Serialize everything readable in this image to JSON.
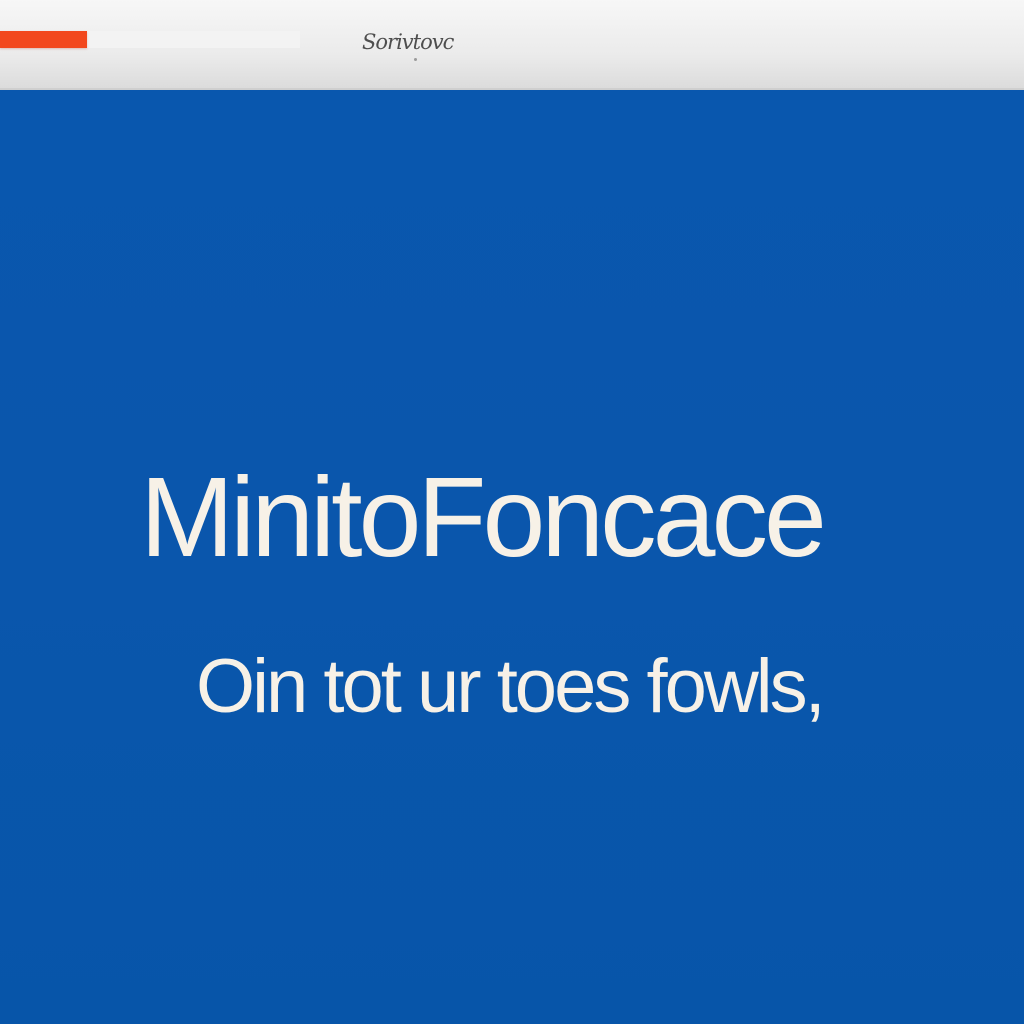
{
  "window": {
    "top_label": "Sorivtovc",
    "progress_percent": 29
  },
  "content": {
    "headline": "MinitoFoncace",
    "subheadline": "Oin tot ur toes fowls,"
  },
  "colors": {
    "background": "#0a57ad",
    "progress": "#f2481d",
    "text": "#f7f1e7"
  }
}
